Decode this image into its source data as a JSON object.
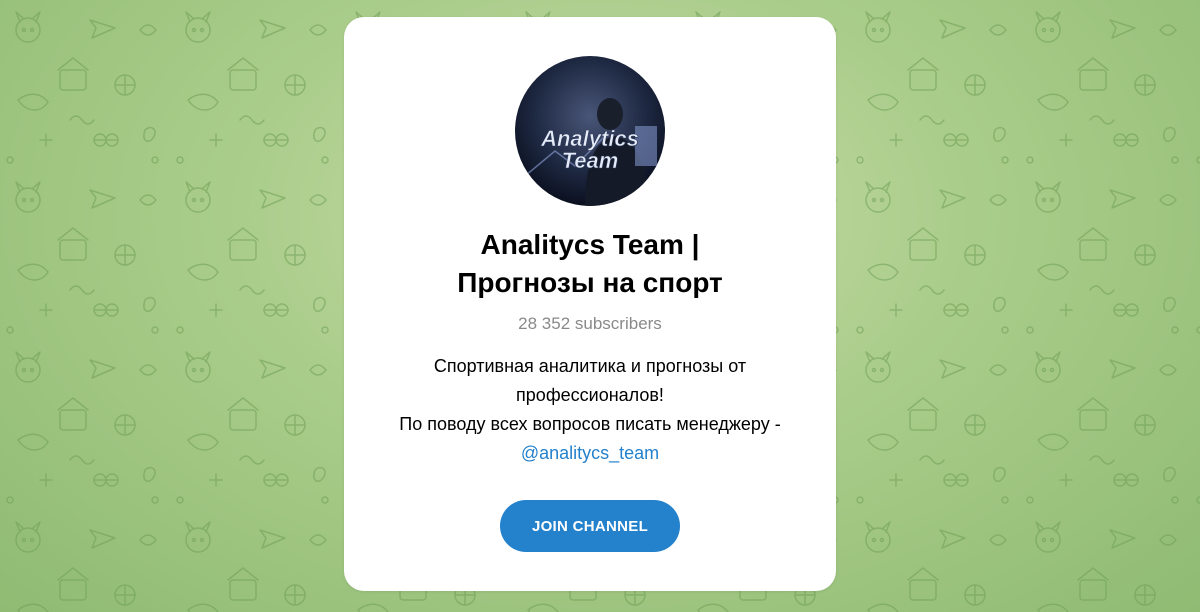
{
  "channel": {
    "title_line1": "Analitycs Team |",
    "title_line2": "Прогнозы на спорт",
    "subscribers": "28 352 subscribers",
    "description_line1": "Спортивная аналитика и прогнозы от",
    "description_line2": "профессионалов!",
    "description_line3": "По поводу всех вопросов писать менеджеру -",
    "manager_link": "@analitycs_team",
    "avatar_text_line1": "Analytics",
    "avatar_text_line2": "Team"
  },
  "join_button": {
    "label": "JOIN CHANNEL"
  },
  "colors": {
    "accent": "#2481cc",
    "background": "#a9cc8a",
    "card": "#ffffff",
    "muted": "#8a8a8a"
  },
  "icons": {
    "background_pattern": "doodle-pattern"
  }
}
